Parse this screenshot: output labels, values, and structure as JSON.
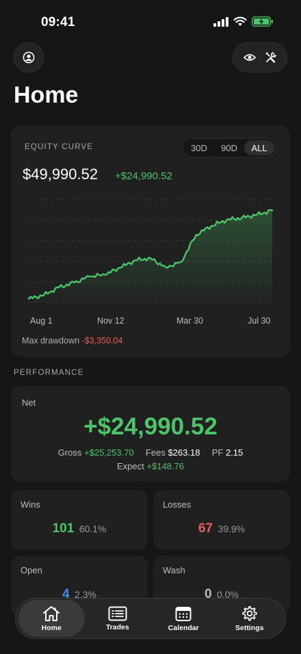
{
  "status": {
    "time": "09:41"
  },
  "header": {
    "title": "Home"
  },
  "equity": {
    "label": "EQUITY CURVE",
    "ranges": [
      "30D",
      "90D",
      "ALL"
    ],
    "selected_range": "ALL",
    "value": "$49,990.52",
    "change": "+$24,990.52",
    "drawdown_label": "Max drawdown",
    "drawdown_value": "-$3,350.04",
    "accent_color": "#4cc46a"
  },
  "chart_data": {
    "type": "area",
    "x_ticks": [
      "Aug 1",
      "Nov 12",
      "Mar 30",
      "Jul 30"
    ],
    "values": [
      25000,
      26100,
      28300,
      29600,
      31300,
      31800,
      33800,
      35900,
      36500,
      33900,
      35400,
      43100,
      45600,
      47300,
      47900,
      48800,
      49990.52
    ],
    "ylim": [
      24000,
      53000
    ],
    "grid": true,
    "legend": "none"
  },
  "performance": {
    "section_label": "PERFORMANCE",
    "net_label": "Net",
    "net_value": "+$24,990.52",
    "gross_label": "Gross",
    "gross_value": "+$25,253.70",
    "fees_label": "Fees",
    "fees_value": "$263.18",
    "pf_label": "PF",
    "pf_value": "2.15",
    "expect_label": "Expect",
    "expect_value": "+$148.76"
  },
  "stats": {
    "wins": {
      "label": "Wins",
      "count": "101",
      "pct": "60.1%",
      "color": "#4cc46a"
    },
    "losses": {
      "label": "Losses",
      "count": "67",
      "pct": "39.9%",
      "color": "#f05a5a"
    },
    "open": {
      "label": "Open",
      "count": "4",
      "pct": "2.3%",
      "color": "#3a8fe8"
    },
    "wash": {
      "label": "Wash",
      "count": "0",
      "pct": "0.0%",
      "color": "#bdbdbd"
    }
  },
  "nav": {
    "items": [
      {
        "label": "Home",
        "icon": "home-icon",
        "active": true
      },
      {
        "label": "Trades",
        "icon": "trades-icon",
        "active": false
      },
      {
        "label": "Calendar",
        "icon": "calendar-icon",
        "active": false
      },
      {
        "label": "Settings",
        "icon": "gear-icon",
        "active": false
      }
    ]
  }
}
